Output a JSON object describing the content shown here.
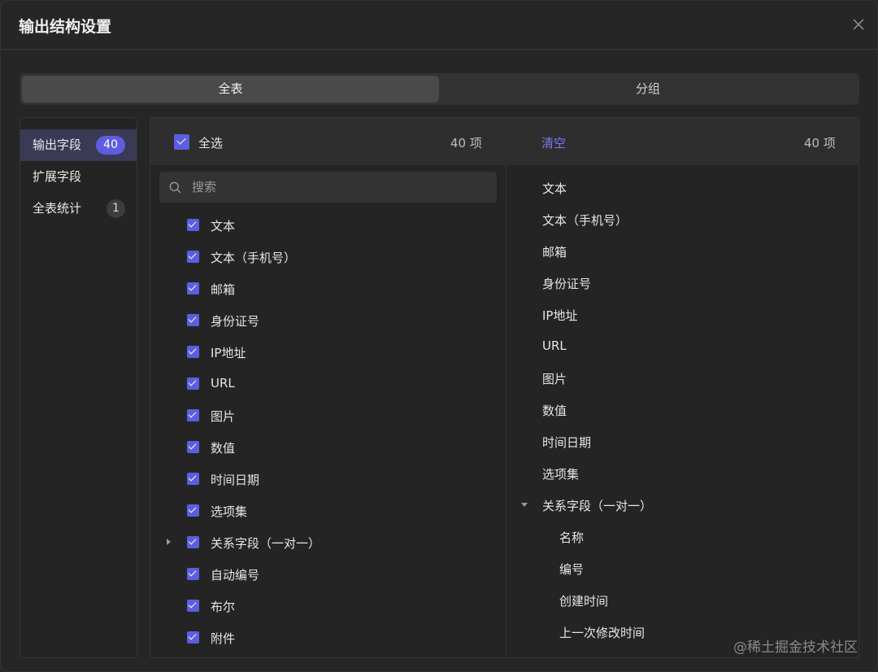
{
  "dialog": {
    "title": "输出结构设置"
  },
  "tabs": [
    {
      "label": "全表"
    },
    {
      "label": "分组"
    }
  ],
  "sidebar": {
    "items": [
      {
        "label": "输出字段",
        "badge": "40"
      },
      {
        "label": "扩展字段",
        "badge": ""
      },
      {
        "label": "全表统计",
        "badge": "1"
      }
    ]
  },
  "left": {
    "select_all": "全选",
    "count": "40 项",
    "search_placeholder": "搜索",
    "fields": [
      {
        "label": "文本",
        "checked": true,
        "expandable": false
      },
      {
        "label": "文本（手机号）",
        "checked": true,
        "expandable": false
      },
      {
        "label": "邮箱",
        "checked": true,
        "expandable": false
      },
      {
        "label": "身份证号",
        "checked": true,
        "expandable": false
      },
      {
        "label": "IP地址",
        "checked": true,
        "expandable": false
      },
      {
        "label": "URL",
        "checked": true,
        "expandable": false
      },
      {
        "label": "图片",
        "checked": true,
        "expandable": false
      },
      {
        "label": "数值",
        "checked": true,
        "expandable": false
      },
      {
        "label": "时间日期",
        "checked": true,
        "expandable": false
      },
      {
        "label": "选项集",
        "checked": true,
        "expandable": false
      },
      {
        "label": "关系字段（一对一）",
        "checked": true,
        "expandable": true
      },
      {
        "label": "自动编号",
        "checked": true,
        "expandable": false
      },
      {
        "label": "布尔",
        "checked": true,
        "expandable": false
      },
      {
        "label": "附件",
        "checked": true,
        "expandable": false
      }
    ]
  },
  "right": {
    "clear": "清空",
    "count": "40 项",
    "fields": [
      {
        "label": "文本",
        "level": 0
      },
      {
        "label": "文本（手机号）",
        "level": 0
      },
      {
        "label": "邮箱",
        "level": 0
      },
      {
        "label": "身份证号",
        "level": 0
      },
      {
        "label": "IP地址",
        "level": 0
      },
      {
        "label": "URL",
        "level": 0
      },
      {
        "label": "图片",
        "level": 0
      },
      {
        "label": "数值",
        "level": 0
      },
      {
        "label": "时间日期",
        "level": 0
      },
      {
        "label": "选项集",
        "level": 0
      },
      {
        "label": "关系字段（一对一）",
        "level": 0,
        "expanded": true
      },
      {
        "label": "名称",
        "level": 1
      },
      {
        "label": "编号",
        "level": 1
      },
      {
        "label": "创建时间",
        "level": 1
      },
      {
        "label": "上一次修改时间",
        "level": 1
      }
    ]
  },
  "watermark": "@稀土掘金技术社区",
  "colors": {
    "accent": "#5e5de0",
    "link": "#7b78f2",
    "background": "#262626"
  }
}
